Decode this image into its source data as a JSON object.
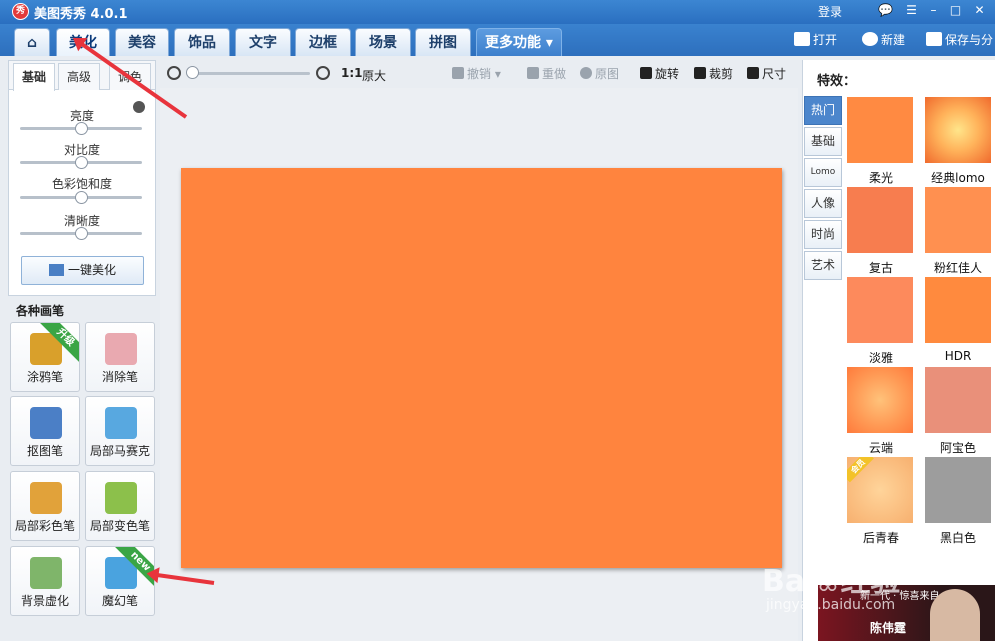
{
  "app": {
    "logo_text": "秀",
    "title": "美图秀秀 4.0.1",
    "login": "登录"
  },
  "window_controls": {
    "feedback": "💬",
    "menu": "☰",
    "minimize": "–",
    "maximize": "□",
    "close": "✕"
  },
  "tabs": [
    {
      "label": "美化",
      "active": true
    },
    {
      "label": "美容"
    },
    {
      "label": "饰品"
    },
    {
      "label": "文字"
    },
    {
      "label": "边框"
    },
    {
      "label": "场景"
    },
    {
      "label": "拼图"
    },
    {
      "label": "更多功能 ▾"
    }
  ],
  "home_icon": "⌂",
  "actions": {
    "open": "打开",
    "new": "新建",
    "save": "保存与分"
  },
  "left": {
    "tabs": [
      "基础",
      "高级",
      "调色"
    ],
    "sliders": [
      {
        "label": "亮度",
        "value": 0.5
      },
      {
        "label": "对比度",
        "value": 0.5
      },
      {
        "label": "色彩饱和度",
        "value": 0.5
      },
      {
        "label": "清晰度",
        "value": 0.5
      }
    ],
    "auto_button": "一键美化",
    "brush_title": "各种画笔",
    "brushes": [
      {
        "label": "涂鸦笔",
        "badge": "升级",
        "color": "#d9a02b"
      },
      {
        "label": "消除笔",
        "badge": "",
        "color": "#e9a9b0"
      },
      {
        "label": "抠图笔",
        "badge": "",
        "color": "#4b7fc6"
      },
      {
        "label": "局部马赛克",
        "badge": "",
        "color": "#58a8e0"
      },
      {
        "label": "局部彩色笔",
        "badge": "",
        "color": "#e1a23a"
      },
      {
        "label": "局部变色笔",
        "badge": "",
        "color": "#8cc04b"
      },
      {
        "label": "背景虚化",
        "badge": "",
        "color": "#7fb56a"
      },
      {
        "label": "魔幻笔",
        "badge": "new",
        "color": "#4aa3df"
      }
    ]
  },
  "toolbar": {
    "zoom_ratio": "1:1",
    "zoom_original": "原大",
    "zoom_level": 0.0,
    "undo": "撤销",
    "redo": "重做",
    "original": "原图",
    "rotate": "旋转",
    "crop": "裁剪",
    "size": "尺寸"
  },
  "photo_color": "#ff843e",
  "right": {
    "title": "特效：",
    "categories": [
      "热门",
      "基础",
      "Lomo",
      "人像",
      "时尚",
      "艺术"
    ],
    "effects": [
      {
        "label": "柔光",
        "color": "#ff8a42"
      },
      {
        "label": "经典lomo",
        "color": "radial-gradient(circle, #ffe58a 0%, #ffb25a 45%, #f06a2d 100%)"
      },
      {
        "label": "复古",
        "color": "#f77d4f"
      },
      {
        "label": "粉红佳人",
        "color": "#ff9050"
      },
      {
        "label": "淡雅",
        "color": "#fd8a5c"
      },
      {
        "label": "HDR",
        "color": "#ff8a3e"
      },
      {
        "label": "云端",
        "color": "radial-gradient(circle, #ffc27a 0%, #ff9a55 55%, #ff7a3b 100%)"
      },
      {
        "label": "阿宝色",
        "color": "#e9907a"
      },
      {
        "label": "后青春",
        "color": "radial-gradient(circle, #ffd49a 0%, #f7b06f 100%)",
        "badge": "会员"
      },
      {
        "label": "黑白色",
        "color": "#9d9d9d"
      }
    ]
  },
  "ad": {
    "tagline": "新一代 · 惊喜来自",
    "name": "陈伟霆"
  },
  "watermark": {
    "main": "Bai❀经验",
    "sub": "jingyan.baidu.com"
  }
}
